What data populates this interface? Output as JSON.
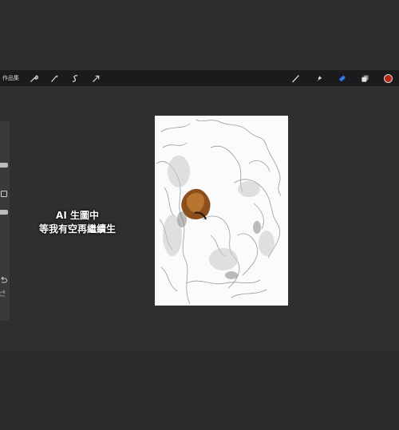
{
  "toolbar": {
    "gallery_label": "作品集",
    "left_tools": [
      {
        "icon": "wrench-icon"
      },
      {
        "icon": "adjustments-wand-icon"
      },
      {
        "icon": "selection-icon"
      },
      {
        "icon": "transform-arrow-icon"
      }
    ],
    "right_tools": [
      {
        "icon": "brush-icon"
      },
      {
        "icon": "smudge-icon"
      },
      {
        "icon": "eraser-icon"
      },
      {
        "icon": "layers-icon"
      }
    ],
    "active_color": "#b62b18"
  },
  "overlay_caption": {
    "line1": "AI 生圖中",
    "line2": "等我有空再繼續生"
  },
  "colors": {
    "background": "#2c2c2e",
    "toolbar": "#1b1b1d",
    "eraser_active": "#2d7be8",
    "canvas": "#fbfbfb"
  }
}
